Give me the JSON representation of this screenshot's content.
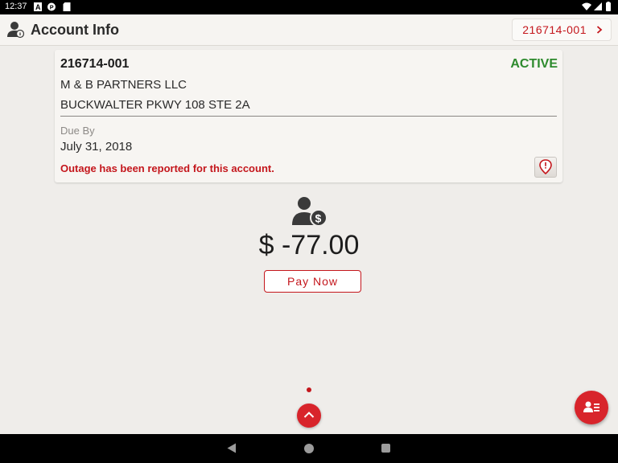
{
  "status_bar": {
    "time": "12:37",
    "left_icons": [
      "a-icon",
      "p-icon",
      "sd-card-icon"
    ],
    "right_icons": [
      "wifi-icon",
      "signal-icon",
      "battery-icon"
    ]
  },
  "app_bar": {
    "title": "Account Info",
    "account_selector": "216714-001",
    "icons": [
      "account-user-icon",
      "chevron-right-icon"
    ]
  },
  "account_card": {
    "account_number": "216714-001",
    "status": "ACTIVE",
    "customer_name": "M & B PARTNERS LLC",
    "service_address": "BUCKWALTER PKWY 108 STE 2A",
    "due_by_label": "Due By",
    "due_date": "July 31, 2018",
    "outage_message": "Outage has been reported for this account.",
    "outage_icon": "map-pin-icon"
  },
  "balance": {
    "icon": "user-dollar-icon",
    "amount": "$ -77.00",
    "pay_label": "Pay Now"
  },
  "colors": {
    "brand_red": "#c4161c",
    "active_green": "#2d8a2d",
    "background": "#efedea"
  },
  "pager": {
    "current": 1
  },
  "fab_icon": "account-list-icon",
  "nav_icons": [
    "back-icon",
    "home-icon",
    "recents-icon"
  ]
}
